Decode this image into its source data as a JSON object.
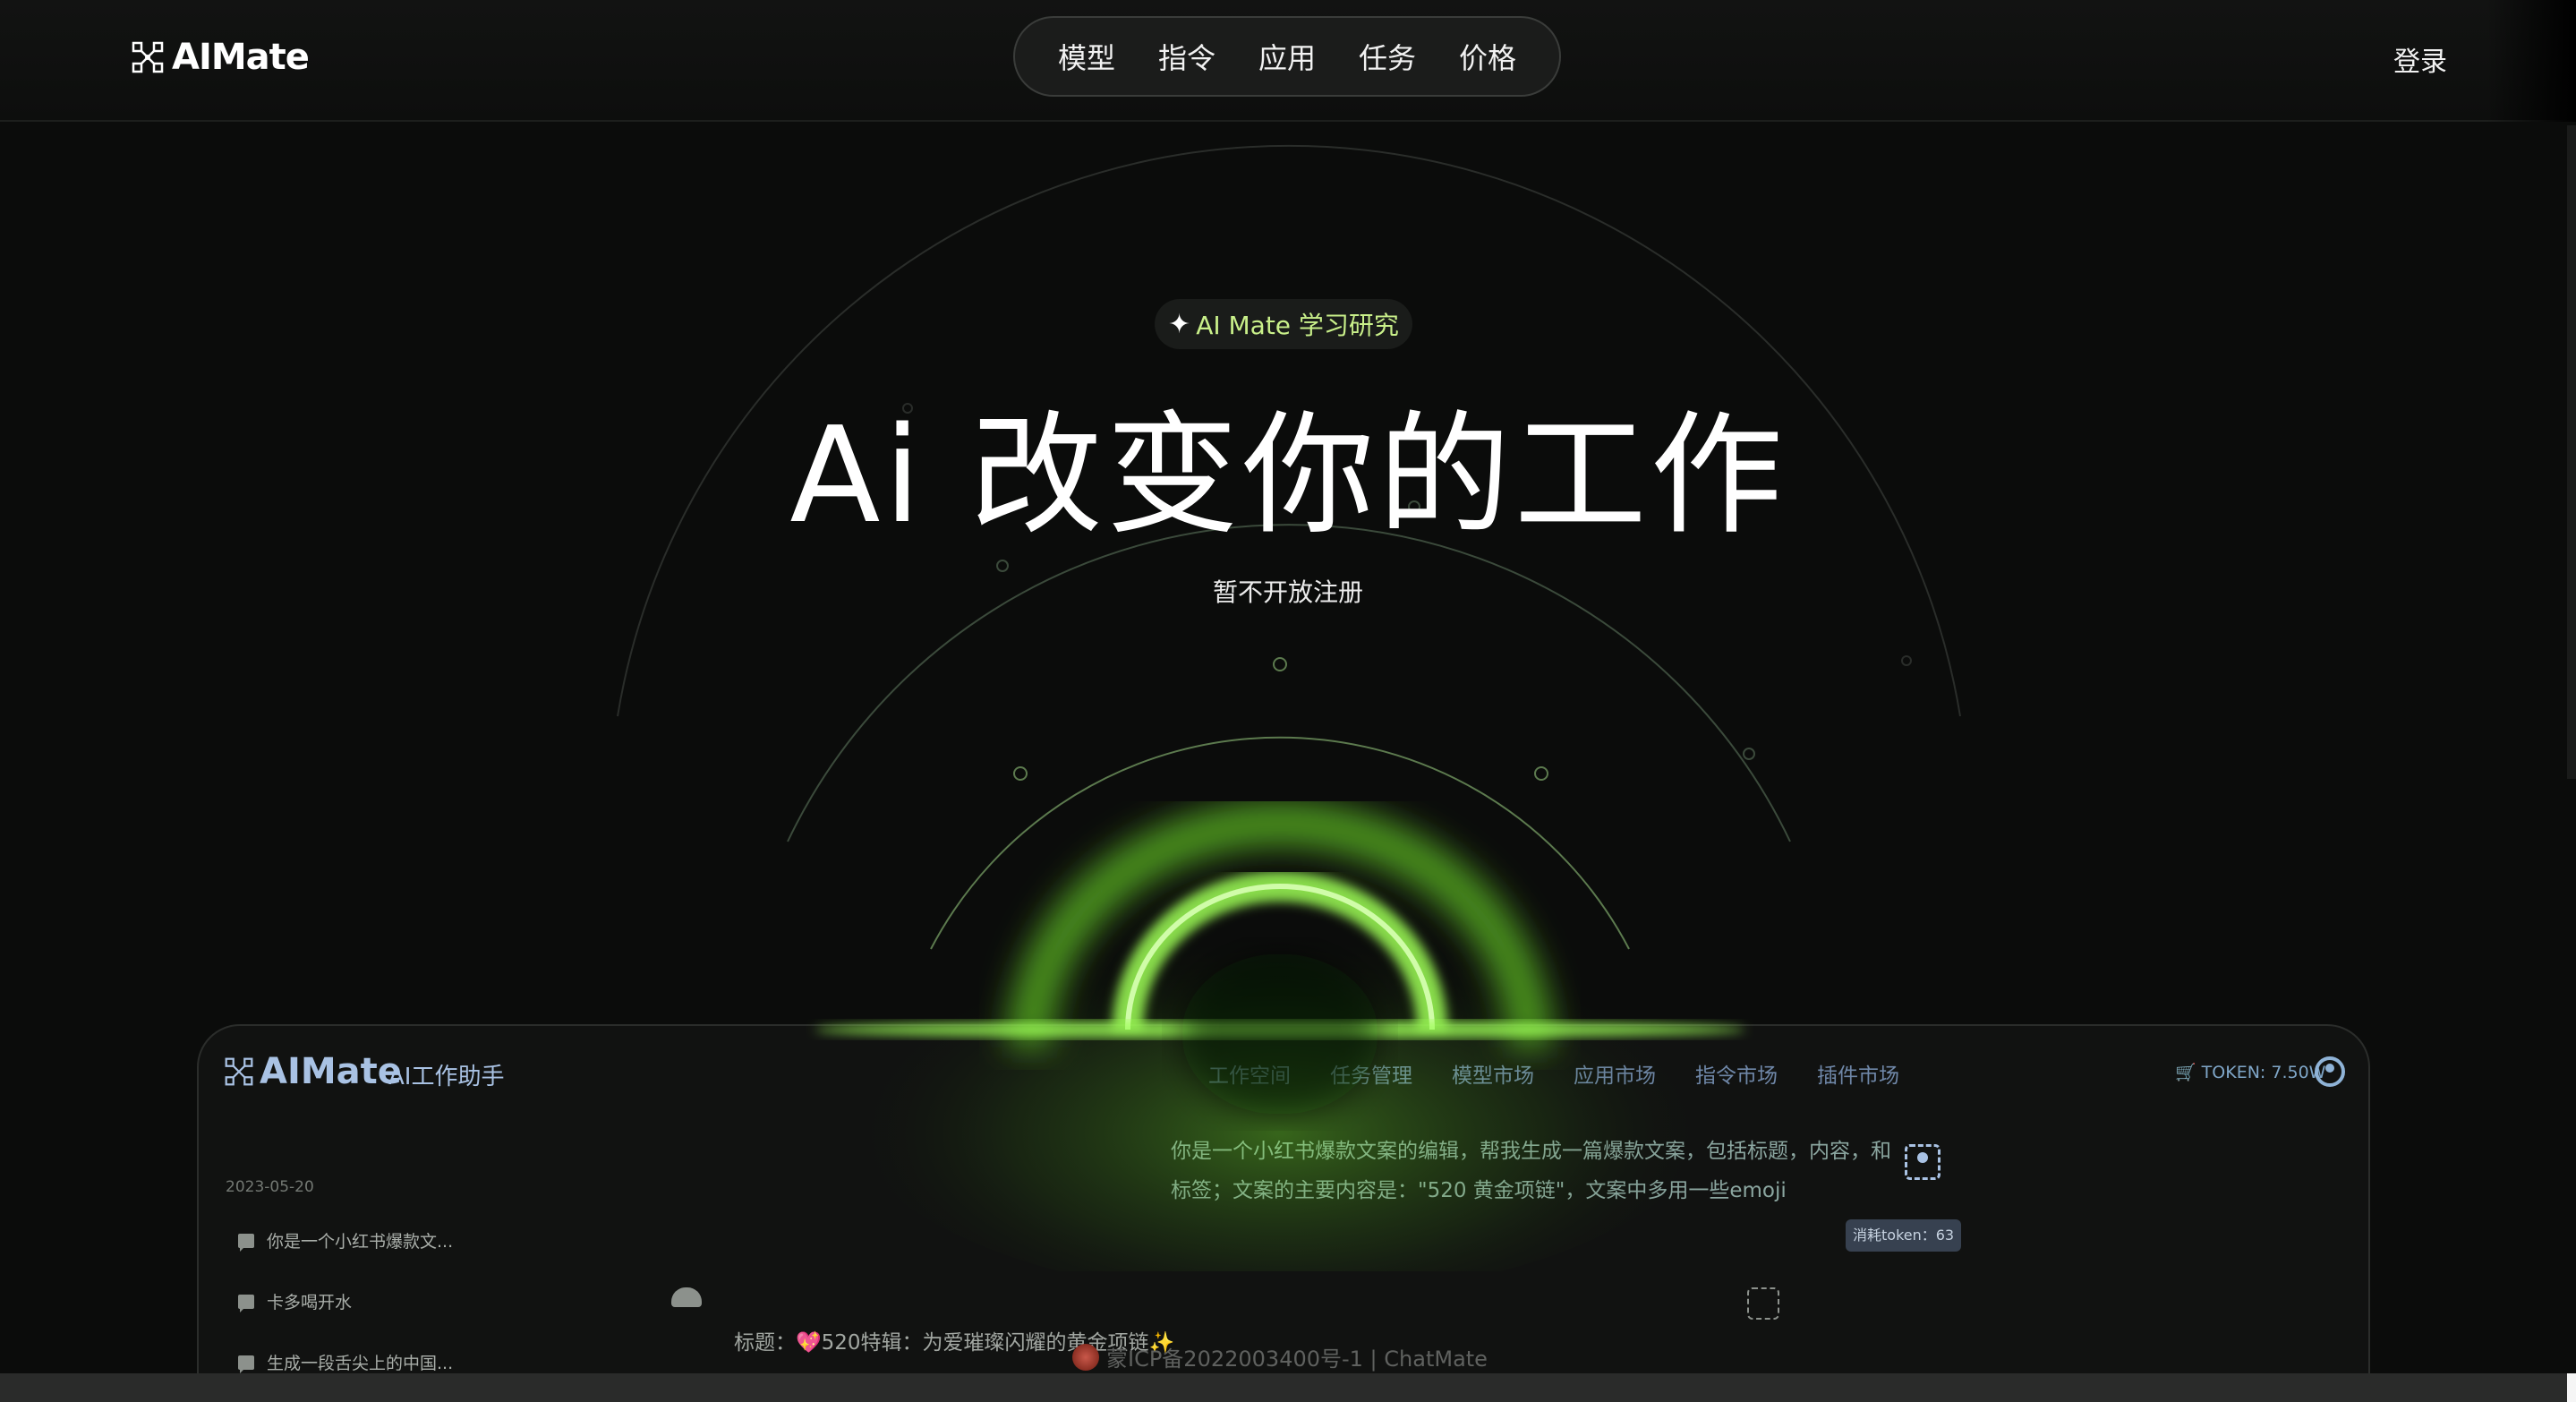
{
  "header": {
    "logo_text": "AIMate",
    "nav": [
      "模型",
      "指令",
      "应用",
      "任务",
      "价格"
    ],
    "login_label": "登录"
  },
  "hero": {
    "badge": "AI Mate 学习研究",
    "title": "Ai 改变你的工作",
    "subtitle": "暂不开放注册"
  },
  "preview": {
    "logo_text": "AIMate",
    "assistant_label": "AI工作助手",
    "nav": [
      "工作空间",
      "任务管理",
      "模型市场",
      "应用市场",
      "指令市场",
      "插件市场"
    ],
    "token_text": "TOKEN: 7.50W",
    "history_date": "2023-05-20",
    "conversations": [
      "你是一个小红书爆款文...",
      "卡多喝开水",
      "生成一段舌尖上的中国..."
    ],
    "user_message": "你是一个小红书爆款文案的编辑，帮我生成一篇爆款文案，包括标题，内容，和标签；文案的主要内容是：\"520 黄金项链\"，文案中多用一些emoji",
    "token_cost": "消耗token：63",
    "reply_preview": "标题：💖520特辑：为爱璀璨闪耀的黄金项链✨"
  },
  "footer": {
    "icp": "蒙ICP备2022003400号-1 | ChatMate"
  },
  "colors": {
    "accent_green": "#7dff2e",
    "badge_text": "#c9f08a",
    "background": "#0b0c0b"
  },
  "icons": [
    "logo-mark-icon",
    "sparkle-icon",
    "chat-icon",
    "cart-icon",
    "user-icon",
    "bot-icon",
    "copy-icon",
    "police-badge-icon"
  ]
}
